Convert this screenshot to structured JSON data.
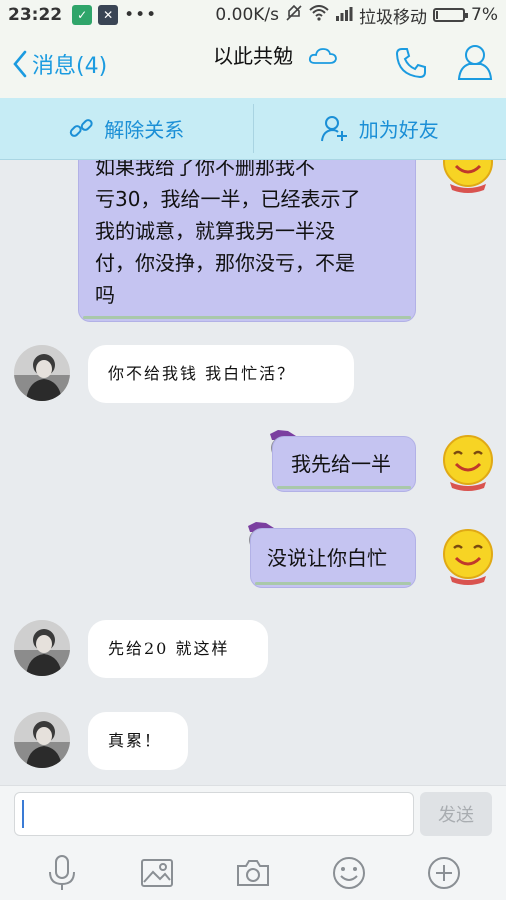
{
  "status": {
    "time": "23:22",
    "dots": "•••",
    "speed": "0.00K/s",
    "carrier": "拉圾移动",
    "battery": "7%",
    "battery_level": 0.07
  },
  "header": {
    "back_label": "消息(4)",
    "title": "以此共勉"
  },
  "actions": {
    "remove": "解除关系",
    "add": "加为好友"
  },
  "messages": [
    {
      "text_lines": [
        "如果我给了你不删那我不",
        "亏30，我给一半，已经表示了",
        "我的诚意，就算我另一半没",
        "付，你没挣，那你没亏，不是",
        "吗"
      ]
    },
    {
      "text": "你不给我钱 我白忙活？"
    },
    {
      "text": "我先给一半"
    },
    {
      "text": "没说让你白忙"
    },
    {
      "text": "先给20  就这样"
    },
    {
      "text": "真累！"
    }
  ],
  "input": {
    "value": "",
    "send_label": "发送"
  }
}
